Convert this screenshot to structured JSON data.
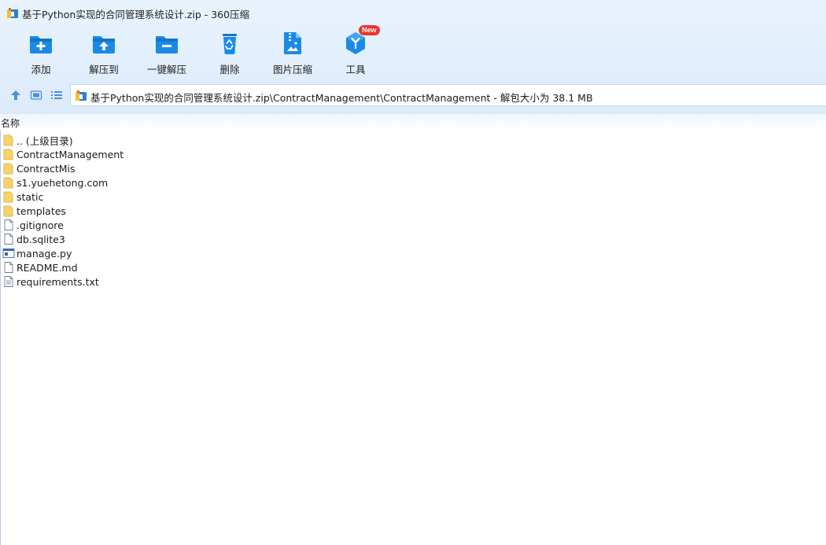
{
  "window": {
    "title": "基于Python实现的合同管理系统设计.zip - 360压缩"
  },
  "toolbar": {
    "items": [
      {
        "label": "添加",
        "icon": "add-folder-icon"
      },
      {
        "label": "解压到",
        "icon": "extract-to-icon"
      },
      {
        "label": "一键解压",
        "icon": "one-click-extract-icon"
      },
      {
        "label": "删除",
        "icon": "delete-bin-icon"
      },
      {
        "label": "图片压缩",
        "icon": "image-compress-icon"
      },
      {
        "label": "工具",
        "icon": "tools-icon",
        "badge": "New"
      }
    ]
  },
  "navigation": {
    "address": "基于Python实现的合同管理系统设计.zip\\ContractManagement\\ContractManagement - 解包大小为 38.1 MB"
  },
  "file_list": {
    "column_header": "名称",
    "items": [
      {
        "name": ".. (上级目录)",
        "type": "folder"
      },
      {
        "name": "ContractManagement",
        "type": "folder"
      },
      {
        "name": "ContractMis",
        "type": "folder"
      },
      {
        "name": "s1.yuehetong.com",
        "type": "folder"
      },
      {
        "name": "static",
        "type": "folder"
      },
      {
        "name": "templates",
        "type": "folder"
      },
      {
        "name": ".gitignore",
        "type": "file"
      },
      {
        "name": "db.sqlite3",
        "type": "file"
      },
      {
        "name": "manage.py",
        "type": "python"
      },
      {
        "name": "README.md",
        "type": "file"
      },
      {
        "name": "requirements.txt",
        "type": "text"
      }
    ]
  },
  "colors": {
    "accent": "#1a8ae6",
    "header_bg": "#e1eefc",
    "folder": "#f7d36b",
    "badge": "#e8362f"
  }
}
